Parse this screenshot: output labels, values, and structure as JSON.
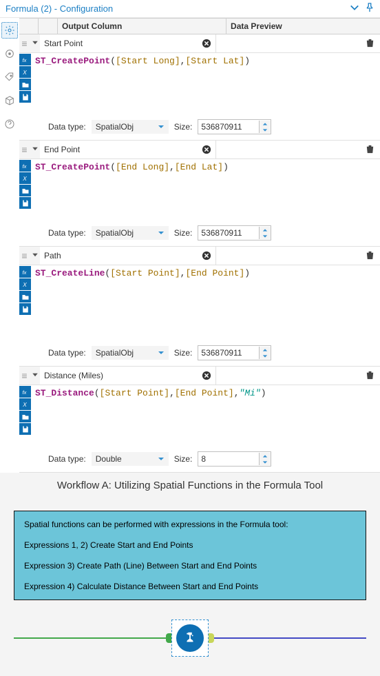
{
  "header": {
    "title": "Formula (2) - Configuration"
  },
  "columns": {
    "output": "Output Column",
    "preview": "Data Preview"
  },
  "labels": {
    "data_type": "Data type:",
    "size": "Size:"
  },
  "rows": [
    {
      "column": "Start Point",
      "expr": {
        "fn1": "ST_CreatePoint",
        "open": "(",
        "f1": "[Start Long]",
        "sep1": ",",
        "f2": "[Start Lat]",
        "close": ")"
      },
      "dtype": "SpatialObj",
      "size": "536870911"
    },
    {
      "column": "End Point",
      "expr": {
        "fn1": "ST_CreatePoint",
        "open": "(",
        "f1": "[End Long]",
        "sep1": ",",
        "f2": "[End Lat]",
        "close": ")"
      },
      "dtype": "SpatialObj",
      "size": "536870911"
    },
    {
      "column": "Path",
      "expr": {
        "fn1": "ST_CreateLine",
        "open": "(",
        "f1": "[Start Point]",
        "sep1": ",",
        "f2": "[End Point]",
        "close": ")"
      },
      "dtype": "SpatialObj",
      "size": "536870911"
    },
    {
      "column": "Distance (Miles)",
      "expr": {
        "fn1": "ST_Distance",
        "open": "(",
        "f1": "[Start Point]",
        "sep1": ",",
        "f2": "[End Point]",
        "sep2": ",",
        "str1": "\"Mi\"",
        "close": ")"
      },
      "dtype": "Double",
      "size": "8"
    }
  ],
  "footer": {
    "title": "Workflow A: Utilizing Spatial Functions in the Formula Tool",
    "info": [
      "Spatial functions can be performed with expressions in the Formula tool:",
      "Expressions 1, 2) Create Start and End Points",
      "Expression 3) Create Path (Line) Between Start and End Points",
      "Expression 4) Calculate Distance Between Start and End Points"
    ]
  }
}
